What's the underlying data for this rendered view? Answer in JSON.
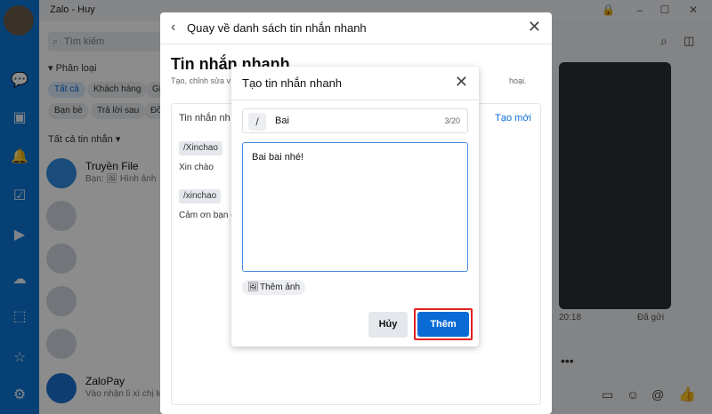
{
  "app": {
    "title": "Zalo - Huy"
  },
  "nav": {
    "icons": [
      "chat-icon",
      "contacts-icon",
      "bell-icon",
      "todo-icon",
      "video-icon",
      "cloud-icon",
      "screenshot-icon",
      "star-icon",
      "settings-icon"
    ]
  },
  "sidebar": {
    "search_placeholder": "Tìm kiếm",
    "section_label": "Phân loại",
    "chips": [
      "Tất cả",
      "Khách hàng",
      "Gi",
      "Bạn bè",
      "Trả lời sau",
      "Đồ"
    ],
    "all_messages": "Tất cả tin nhắn",
    "conversations": [
      {
        "name": "Truyền File",
        "preview": "Bạn: 🖼 Hình ảnh"
      },
      {
        "name": "ZaloPay",
        "preview": "Vào nhận lì xì chị k"
      }
    ]
  },
  "outer_modal": {
    "back_label": "Quay về danh sách tin nhắn nhanh",
    "heading": "Tin nhắn nhanh",
    "description": "Tạo, chỉnh sửa v",
    "description_tail": "hoại.",
    "list_header": "Tin nhắn nh",
    "create_new": "Tạo mới",
    "items": [
      {
        "shortcut": "/Xinchao",
        "message": "Xin chào"
      },
      {
        "shortcut": "/xinchao",
        "message": "Cảm ơn bạn đ"
      }
    ]
  },
  "dialog": {
    "title": "Tạo tin nhắn nhanh",
    "slash": "/",
    "shortcut_value": "Bai",
    "counter": "3/20",
    "message_value": "Bai bai nhé!",
    "add_image_label": "Thêm ảnh",
    "cancel_label": "Hủy",
    "add_label": "Thêm"
  },
  "chat": {
    "time": "20:18",
    "status": "Đã gửi"
  },
  "colors": {
    "brand": "#0b76d6",
    "primary_button": "#0b6bd6",
    "highlight": "#e02020"
  }
}
